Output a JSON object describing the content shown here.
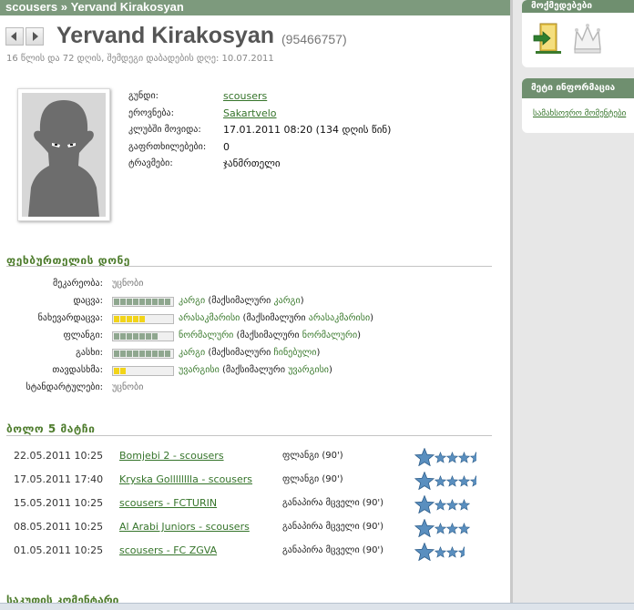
{
  "breadcrumb": {
    "team": "scousers",
    "separator": " » ",
    "player": "Yervand Kirakosyan"
  },
  "player": {
    "name": "Yervand Kirakosyan",
    "id": "(95466757)",
    "age_line": "16 წლის და 72 დღის, შემდეგი დაბადების დღე: 10.07.2011"
  },
  "info": [
    {
      "label": "გუნდი:",
      "value": "scousers",
      "link": true
    },
    {
      "label": "ეროვნება:",
      "value": "Sakartvelo",
      "link": true
    },
    {
      "label": "კლუბში მოვიდა:",
      "value": "17.01.2011 08:20 (134 დღის წინ)",
      "link": false
    },
    {
      "label": "გაფრთხილებები:",
      "value": "0",
      "link": false
    },
    {
      "label": "ტრავმები:",
      "value": "ჯანმრთელი",
      "link": false
    }
  ],
  "skills_title": "ფეხბურთელის დონე",
  "skills": [
    {
      "label": "მეკარეობა:",
      "plain": "უცნობი"
    },
    {
      "label": "დაცვა:",
      "level": 9,
      "color": "#8fa78f",
      "current": "კარგი",
      "max_prefix": " (მაქსიმალური ",
      "max": "კარგი",
      "max_suffix": ")"
    },
    {
      "label": "ნახევარდაცვა:",
      "level": 5,
      "color": "#f2d419",
      "current": "არასაკმარისი",
      "max_prefix": " (მაქსიმალური ",
      "max": "არასაკმარისი",
      "max_suffix": ")"
    },
    {
      "label": "ფლანგი:",
      "level": 7,
      "color": "#8fa78f",
      "current": "ნორმალური",
      "max_prefix": " (მაქსიმალური ",
      "max": "ნორმალური",
      "max_suffix": ")"
    },
    {
      "label": "გასხი:",
      "level": 9,
      "color": "#8fa78f",
      "current": "კარგი",
      "max_prefix": " (მაქსიმალური ",
      "max": "ჩინებული",
      "max_suffix": ")"
    },
    {
      "label": "თავდასხმა:",
      "level": 2,
      "color": "#f2d419",
      "current": "უვარგისი",
      "max_prefix": " (მაქსიმალური ",
      "max": "უვარგისი",
      "max_suffix": ")"
    },
    {
      "label": "სტანდარტულები:",
      "plain": "უცნობი"
    }
  ],
  "matches_title": "ბოლო 5 მატჩი",
  "matches": [
    {
      "date": "22.05.2011 10:25",
      "title": "Bomjebi 2 - scousers",
      "position": "ფლანგი (90')",
      "rating": 4.5
    },
    {
      "date": "17.05.2011 17:40",
      "title": "Kryska Golllllllla - scousers",
      "position": "ფლანგი (90')",
      "rating": 4.5
    },
    {
      "date": "15.05.2011 10:25",
      "title": "scousers - FCTURIN",
      "position": "განაპირა მცველი (90')",
      "rating": 4
    },
    {
      "date": "08.05.2011 10:25",
      "title": "Al Arabi Juniors - scousers",
      "position": "განაპირა მცველი (90')",
      "rating": 4
    },
    {
      "date": "01.05.2011 10:25",
      "title": "scousers - FC ZGVA",
      "position": "განაპირა მცველი (90')",
      "rating": 3.5
    }
  ],
  "cut_title": "საკუთის კომენტარი",
  "sidebar": {
    "actions_title": "მოქმედებები",
    "more_title": "მეტი ინფორმაცია",
    "more_link": "სამახსოვრო მომენტები"
  },
  "colors": {
    "header_green": "#7d9a7d",
    "link_green": "#35742a",
    "star_blue": "#5a8fbf"
  },
  "icons": [
    "back-arrow-icon",
    "forward-arrow-icon",
    "exit-door-icon",
    "crown-icon",
    "star-icon"
  ]
}
